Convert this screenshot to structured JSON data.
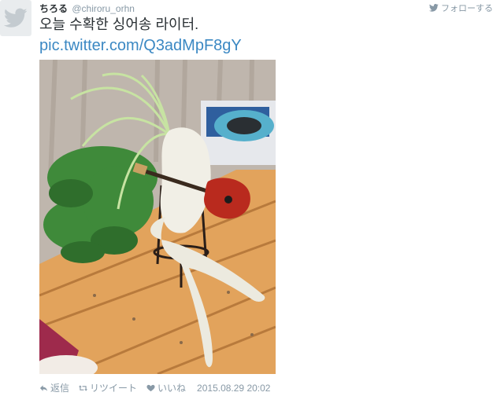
{
  "user": {
    "display_name": "ちろる",
    "handle": "@chiroru_orhn",
    "avatar_icon": "twitter-bird-icon"
  },
  "follow_label": "フォローする",
  "tweet": {
    "text": "오늘 수확한 싱어송 라이터.",
    "link": "pic.twitter.com/Q3adMpF8gY",
    "media_alt": "daikon-radish-with-guitar-photo"
  },
  "actions": {
    "reply_label": "返信",
    "retweet_label": "リツイート",
    "like_label": "いいね",
    "timestamp": "2015.08.29 20:02"
  },
  "colors": {
    "link": "#3b88c3",
    "muted": "#8899a6",
    "text": "#292f33"
  }
}
